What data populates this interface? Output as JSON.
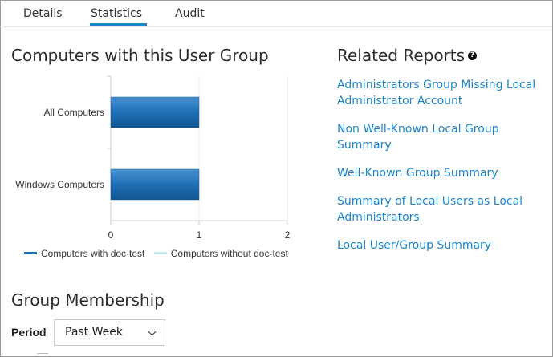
{
  "tabs": [
    {
      "label": "Details"
    },
    {
      "label": "Statistics",
      "active": true
    },
    {
      "label": "Audit"
    }
  ],
  "computers_section": {
    "title": "Computers with this User Group"
  },
  "chart_data": {
    "type": "bar",
    "orientation": "horizontal",
    "categories": [
      "All Computers",
      "Windows Computers"
    ],
    "series": [
      {
        "name": "Computers with doc-test",
        "values": [
          1,
          1
        ],
        "color": "#1f6fb5"
      },
      {
        "name": "Computers without doc-test",
        "values": [
          0,
          0
        ],
        "color": "#c6ebe9"
      }
    ],
    "x_ticks": [
      "0",
      "1",
      "2"
    ],
    "xlim": [
      0,
      2
    ],
    "stacked": true,
    "legend_position": "bottom"
  },
  "related_reports": {
    "title": "Related Reports",
    "help_icon": "question-circle-icon",
    "links": [
      "Administrators Group Missing Local Administrator Account",
      "Non Well-Known Local Group Summary",
      "Well-Known Group Summary",
      "Summary of Local Users as Local Administrators",
      "Local User/Group Summary"
    ]
  },
  "group_membership": {
    "title": "Group Membership",
    "period_label": "Period",
    "period_value": "Past Week"
  },
  "colors": {
    "accent": "#1a86c8",
    "bar": "#1f6fb5"
  }
}
